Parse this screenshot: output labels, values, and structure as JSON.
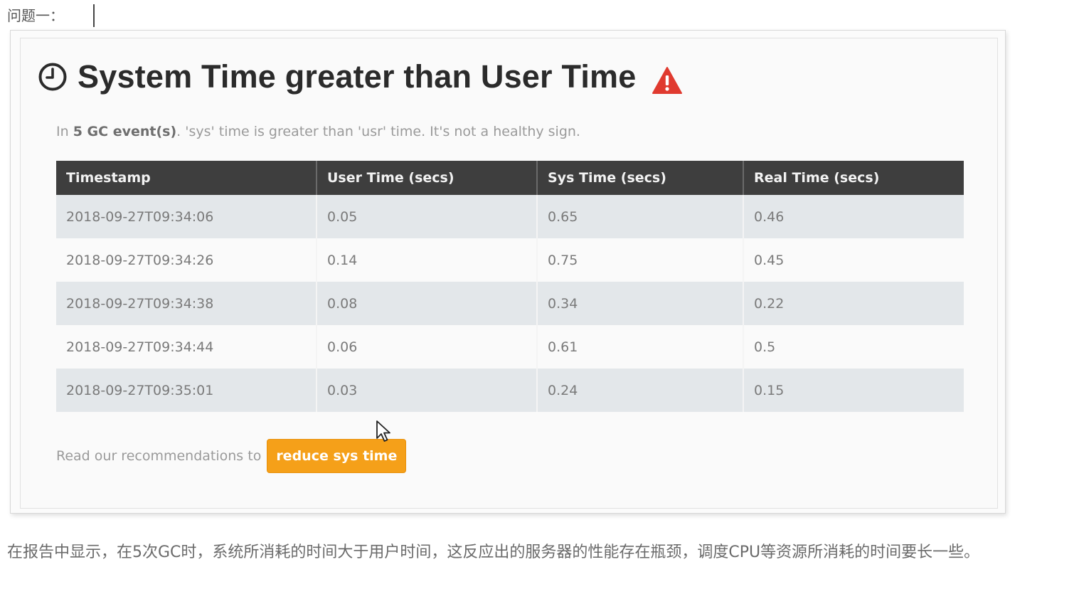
{
  "heading_label": "问题一：",
  "card": {
    "title": "System Time greater than User Time",
    "summary_prefix": "In",
    "summary_bold": "5 GC event(s)",
    "summary_suffix": ". 'sys' time is greater than 'usr' time. It's not a healthy sign.",
    "icons": {
      "title_icon": "clock-icon",
      "alert_icon": "warning-icon"
    },
    "colors": {
      "header_bg": "#3e3e3e",
      "row_odd": "#e3e7ea",
      "button": "#f5a019",
      "warning": "#e03a2f"
    }
  },
  "table": {
    "columns": [
      "Timestamp",
      "User Time (secs)",
      "Sys Time (secs)",
      "Real Time (secs)"
    ],
    "rows": [
      [
        "2018-09-27T09:34:06",
        "0.05",
        "0.65",
        "0.46"
      ],
      [
        "2018-09-27T09:34:26",
        "0.14",
        "0.75",
        "0.45"
      ],
      [
        "2018-09-27T09:34:38",
        "0.08",
        "0.34",
        "0.22"
      ],
      [
        "2018-09-27T09:34:44",
        "0.06",
        "0.61",
        "0.5"
      ],
      [
        "2018-09-27T09:35:01",
        "0.03",
        "0.24",
        "0.15"
      ]
    ]
  },
  "recommendation": {
    "text": "Read our recommendations to",
    "button_label": "reduce sys time"
  },
  "note": "在报告中显示，在5次GC时，系统所消耗的时间大于用户时间，这反应出的服务器的性能存在瓶颈，调度CPU等资源所消耗的时间要长一些。"
}
